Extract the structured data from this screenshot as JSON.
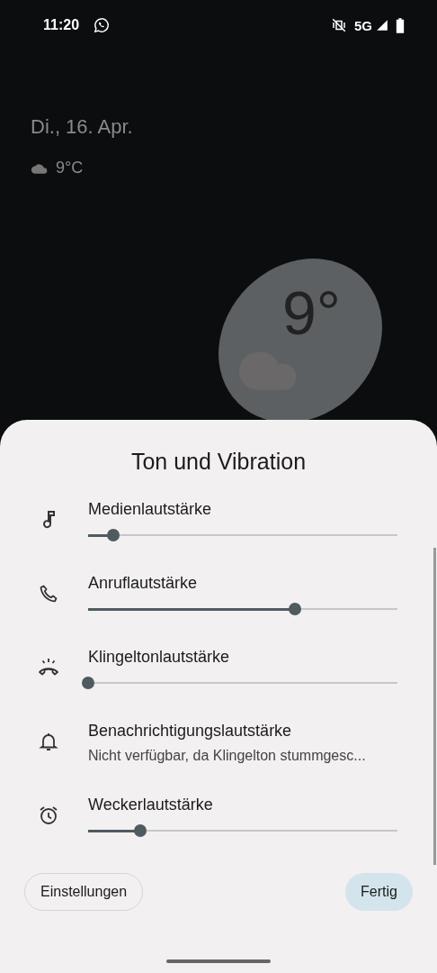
{
  "status_bar": {
    "time": "11:20",
    "network": "5G"
  },
  "lock_screen": {
    "date": "Di., 16. Apr.",
    "weather": "9°C",
    "widget_temperature": "9°"
  },
  "sheet": {
    "title": "Ton und Vibration",
    "rows": [
      {
        "kind": "slider",
        "label": "Medienlautstärke",
        "level": 0.08
      },
      {
        "kind": "slider",
        "label": "Anruflautstärke",
        "level": 0.67
      },
      {
        "kind": "slider",
        "label": "Klingeltonlautstärke",
        "level": 0
      },
      {
        "kind": "info",
        "label": "Benachrichtigungslautstärke",
        "subtitle": "Nicht verfügbar, da Klingelton stummgesc..."
      },
      {
        "kind": "slider",
        "label": "Weckerlautstärke",
        "level": 0.17
      }
    ],
    "buttons": [
      "Einstellungen",
      "Fertig"
    ]
  }
}
